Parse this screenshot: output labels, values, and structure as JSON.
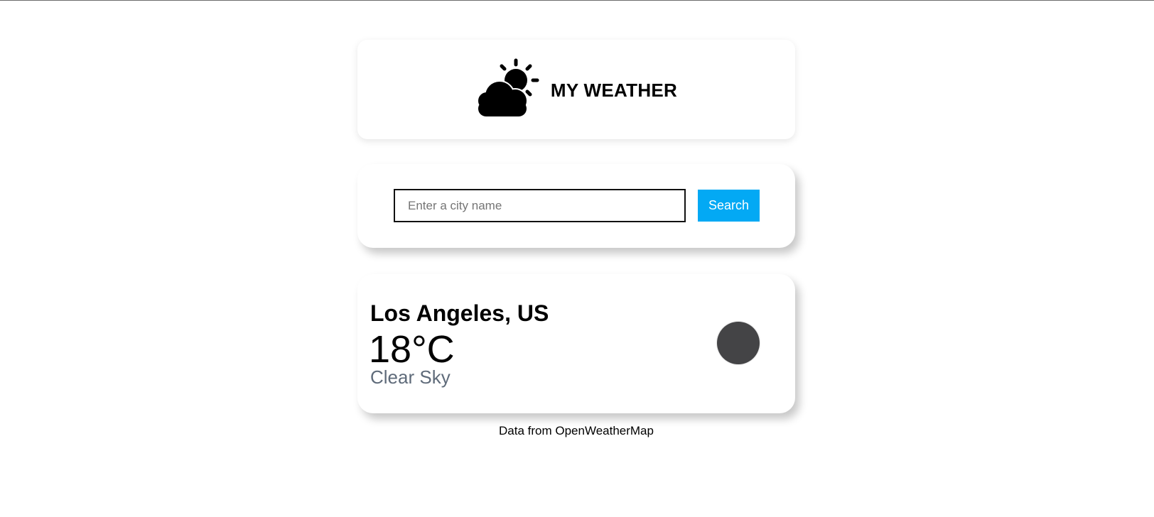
{
  "header": {
    "logo_icon": "sun-behind-cloud-icon",
    "title": "MY WEATHER"
  },
  "search": {
    "placeholder": "Enter a city name",
    "value": "",
    "button_label": "Search",
    "button_color": "#03a9f4"
  },
  "weather": {
    "city": "Los Angeles, US",
    "temperature": "18°C",
    "description": "Clear Sky",
    "icon": "weather-condition-icon",
    "icon_color": "#444446",
    "description_color": "#5f6b7a"
  },
  "footer": {
    "credit": "Data from OpenWeatherMap"
  }
}
